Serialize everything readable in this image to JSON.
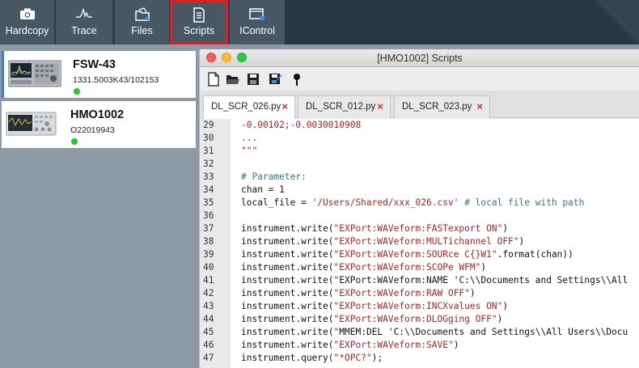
{
  "toolbar": {
    "buttons": [
      {
        "label": "Hardcopy",
        "icon": "camera-icon",
        "active": false
      },
      {
        "label": "Trace",
        "icon": "waveform-icon",
        "active": false
      },
      {
        "label": "Files",
        "icon": "folder-icon",
        "active": false
      },
      {
        "label": "Scripts",
        "icon": "script-document-icon",
        "active": true
      },
      {
        "label": "IControl",
        "icon": "remote-control-icon",
        "active": false
      }
    ]
  },
  "devices": [
    {
      "name": "FSW-43",
      "serial": "1331.5003K43/102153",
      "status": "connected",
      "selected": true
    },
    {
      "name": "HMO1002",
      "serial": "O22019943",
      "status": "connected",
      "selected": false
    }
  ],
  "window": {
    "title": "[HMO1002] Scripts"
  },
  "editor_toolbar": {
    "icons": [
      "new-file-icon",
      "open-folder-icon",
      "save-icon",
      "save-as-icon",
      "run-pin-icon"
    ]
  },
  "tabs": [
    {
      "label": "DL_SCR_026.py",
      "active": true
    },
    {
      "label": "DL_SCR_012.py",
      "active": false
    },
    {
      "label": "DL_SCR_023.py",
      "active": false
    }
  ],
  "colors": {
    "active_highlight": "#e02020",
    "status_dot": "#1ad11a",
    "close_x": "#e02424",
    "string": "#b22222",
    "comment": "#2f7a86",
    "code_text": "#111111"
  },
  "code_lines": [
    {
      "num": "29",
      "text": "-0.00102;-0.0030010908",
      "kind": "string"
    },
    {
      "num": "30",
      "text": "...",
      "kind": "string"
    },
    {
      "num": "31",
      "text": "\"\"\"",
      "kind": "string"
    },
    {
      "num": "32",
      "text": "",
      "kind": "plain"
    },
    {
      "num": "33",
      "text": "# Parameter:",
      "kind": "comment"
    },
    {
      "num": "34",
      "text": "chan = 1",
      "kind": "plain"
    },
    {
      "num": "35",
      "text": "local_file = '/Users/Shared/xxx_026.csv' # local file with path",
      "kind": "mixed"
    },
    {
      "num": "36",
      "text": "",
      "kind": "plain"
    },
    {
      "num": "37",
      "text": "instrument.write(\"EXPort:WAVeform:FASTexport ON\")",
      "kind": "call"
    },
    {
      "num": "38",
      "text": "instrument.write(\"EXPort:WAVeform:MULTichannel OFF\")",
      "kind": "call"
    },
    {
      "num": "39",
      "text": "instrument.write(\"EXPort:WAVeform:SOURce C{}W1\".format(chan))",
      "kind": "call"
    },
    {
      "num": "40",
      "text": "instrument.write(\"EXPort:WAVeform:SCOPe WFM\")",
      "kind": "call"
    },
    {
      "num": "41",
      "text": "instrument.write(\"EXPort:WAVeform:NAME 'C:\\\\Documents and Settings\\\\All",
      "kind": "call"
    },
    {
      "num": "42",
      "text": "instrument.write(\"EXPort:WAVeform:RAW OFF\")",
      "kind": "call"
    },
    {
      "num": "43",
      "text": "instrument.write(\"EXPort:WAVeform:INCXvalues ON\")",
      "kind": "call"
    },
    {
      "num": "44",
      "text": "instrument.write(\"EXPort:WAVeform:DLOGging OFF\")",
      "kind": "call"
    },
    {
      "num": "45",
      "text": "instrument.write(\"MMEM:DEL 'C:\\\\Documents and Settings\\\\All Users\\\\Docu",
      "kind": "call"
    },
    {
      "num": "46",
      "text": "instrument.write(\"EXPort:WAVeform:SAVE\")",
      "kind": "call"
    },
    {
      "num": "47",
      "text": "instrument.query(\"*OPC?\");",
      "kind": "call"
    }
  ]
}
